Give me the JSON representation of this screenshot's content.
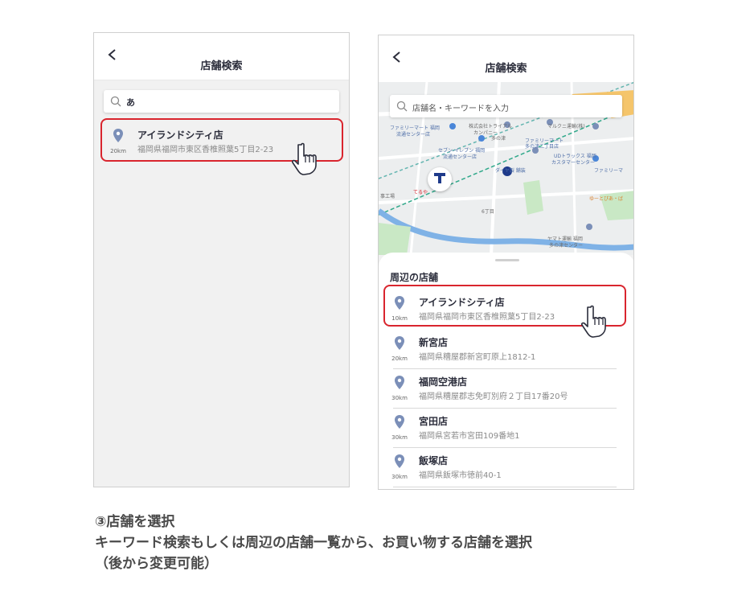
{
  "left_screen": {
    "header": {
      "title": "店舗検索"
    },
    "search": {
      "value": "あ"
    },
    "result": {
      "name": "アイランドシティ店",
      "address": "福岡県福岡市東区香椎照葉5丁目2-23",
      "distance": "20km"
    }
  },
  "right_screen": {
    "header": {
      "title": "店舗検索"
    },
    "search": {
      "placeholder": "店舗名・キーワードを入力"
    },
    "map": {
      "labels": [
        "ファミリーマート 福岡",
        "流通センター店",
        "株式会社トライアル",
        "カンパニー",
        "マルクニ運輸(株)",
        "多の津",
        "セブン-イレブン 福岡",
        "流通センター店",
        "ファミリーマート",
        "多の津二丁目店",
        "UDトラックス 福岡",
        "カスタマーセンター",
        "ダイヤ製 舗装",
        "ファミリーマ",
        "てるや",
        "事工場",
        "6丁目",
        "ヤマト運輸 福岡",
        "多の津センター",
        "ゆーとぴあ・ば"
      ]
    },
    "section_title": "周辺の店舗",
    "stores": [
      {
        "name": "アイランドシティ店",
        "address": "福岡県福岡市東区香椎照葉5丁目2-23",
        "distance": "10km"
      },
      {
        "name": "新宮店",
        "address": "福岡県糟屋郡新宮町原上1812-1",
        "distance": "20km"
      },
      {
        "name": "福岡空港店",
        "address": "福岡県糟屋郡志免町別府２丁目17番20号",
        "distance": "30km"
      },
      {
        "name": "宮田店",
        "address": "福岡県宮若市宮田109番地1",
        "distance": "30km"
      },
      {
        "name": "飯塚店",
        "address": "福岡県飯塚市徳前40-1",
        "distance": "30km"
      }
    ]
  },
  "caption": {
    "line1": "③店舗を選択",
    "line2": "キーワード検索もしくは周辺の店舗一覧から、お買い物する店舗を選択",
    "line3": "（後から変更可能）"
  },
  "colors": {
    "highlight": "#d9252e",
    "pin": "#7b8fb8",
    "location_dot": "#1e3a8a"
  }
}
